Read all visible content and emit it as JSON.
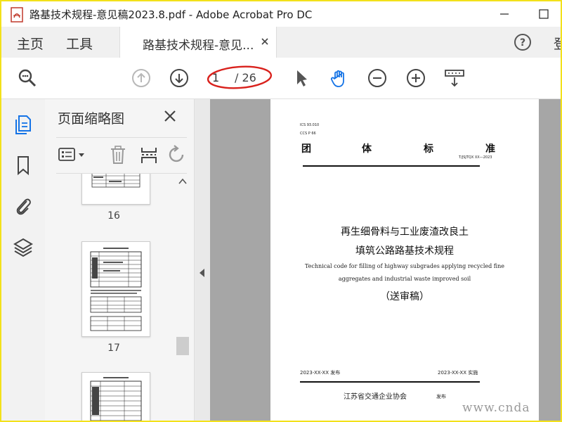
{
  "window": {
    "title": "路基技术规程-意见稿2023.8.pdf - Adobe Acrobat Pro DC"
  },
  "tabs": {
    "home": "主页",
    "tools": "工具",
    "document": "路基技术规程-意见...",
    "cut_off": "登"
  },
  "toolbar": {
    "current_page": "1",
    "total_pages": "/ 26"
  },
  "panel": {
    "title": "页面缩略图",
    "thumbnails": [
      {
        "label": "16"
      },
      {
        "label": "17"
      }
    ]
  },
  "document_page": {
    "ics": "ICS 93.010",
    "ccs": "CCS P 66",
    "standard_chars": [
      "团",
      "体",
      "标",
      "准"
    ],
    "code": "T/JSJTQX XX—2023",
    "title_line1": "再生细骨料与工业废渣改良土",
    "title_line2": "填筑公路路基技术规程",
    "english_line1": "Technical code for filling of highway subgrades applying recycled fine",
    "english_line2": "aggregates and industrial waste improved soil",
    "draft": "（送审稿）",
    "issue_date": "2023-XX-XX 发布",
    "impl_date": "2023-XX-XX 实施",
    "org": "江苏省交通企业协会",
    "issue": "发布"
  },
  "watermark": "www.cnda",
  "colors": {
    "accent_blue": "#1473e6",
    "oval_red": "#d9211c",
    "frame_yellow": "#f3e11a"
  }
}
